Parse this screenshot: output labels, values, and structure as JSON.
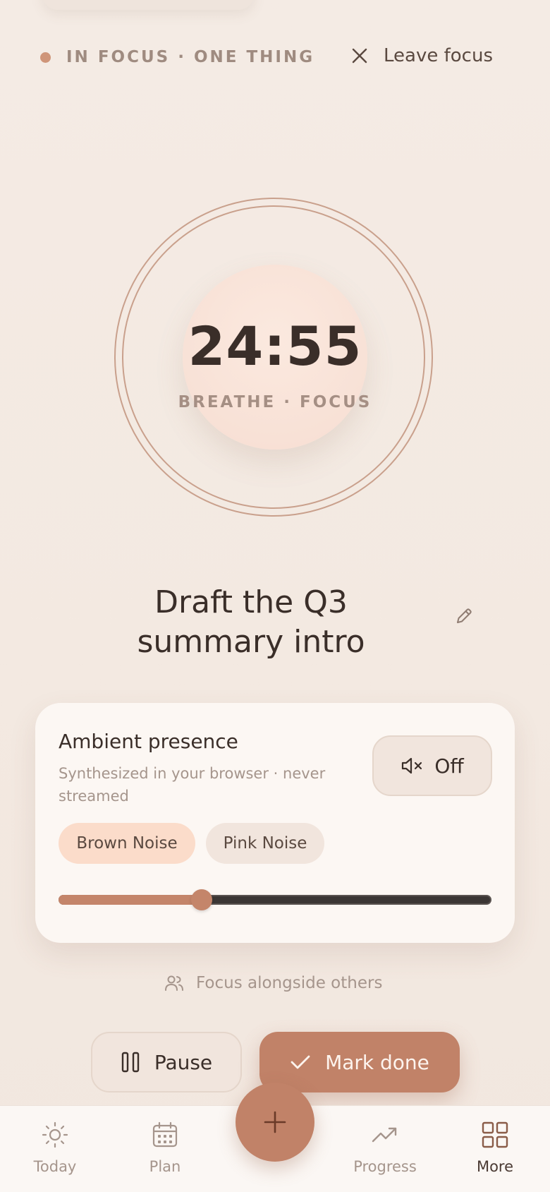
{
  "header": {
    "status_label": "IN FOCUS · ONE THING",
    "leave_label": "Leave focus"
  },
  "timer": {
    "time": "24:55",
    "subtitle": "BREATHE · FOCUS"
  },
  "task": {
    "title": "Draft the Q3 summary intro"
  },
  "ambient": {
    "title": "Ambient presence",
    "subtitle": "Synthesized in your browser · never streamed",
    "sound_toggle_label": "Off",
    "chips": [
      {
        "label": "Brown Noise",
        "active": true
      },
      {
        "label": "Pink Noise",
        "active": false
      }
    ],
    "volume_percent": 33
  },
  "alongside_label": "Focus alongside others",
  "actions": {
    "pause_label": "Pause",
    "done_label": "Mark done"
  },
  "nav": {
    "items": [
      {
        "label": "Today",
        "icon": "sun-icon"
      },
      {
        "label": "Plan",
        "icon": "calendar-icon"
      },
      {
        "label": "Progress",
        "icon": "trending-up-icon"
      },
      {
        "label": "More",
        "icon": "grid-icon"
      }
    ],
    "fab_icon": "plus-icon",
    "active": "More"
  },
  "colors": {
    "accent": "#c18268",
    "accent_soft": "#fbdcca",
    "background": "#f4ebe4",
    "card": "#fcf7f3",
    "text": "#3a2e29",
    "muted": "#a5958c"
  }
}
